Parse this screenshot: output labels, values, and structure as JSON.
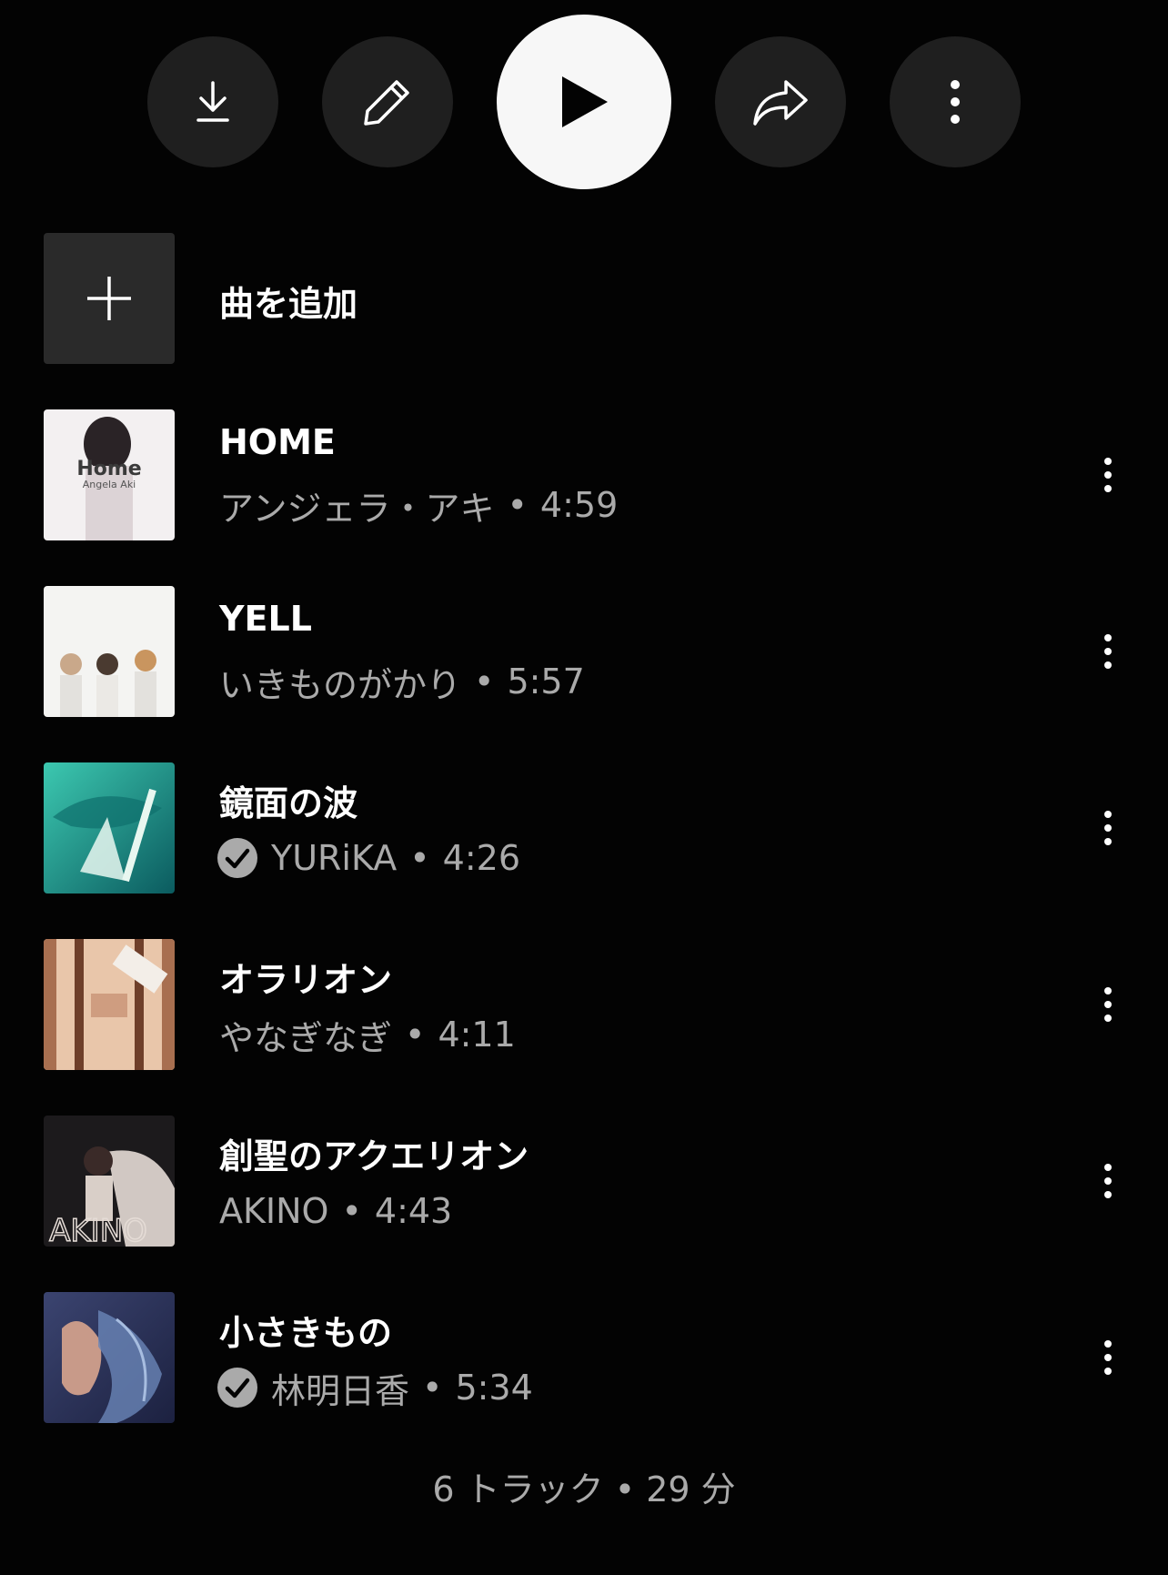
{
  "actions": {
    "download": "download-icon",
    "edit": "pencil-icon",
    "play": "play-icon",
    "share": "share-icon",
    "more": "more-vertical-icon"
  },
  "add_song_label": "曲を追加",
  "separator": "•",
  "tracks": [
    {
      "title": "HOME",
      "artist": "アンジェラ・アキ",
      "duration": "4:59",
      "verified": false,
      "art_colors": [
        "#f2eeee",
        "#d9cfd3",
        "#2a2326"
      ]
    },
    {
      "title": "YELL",
      "artist": "いきものがかり",
      "duration": "5:57",
      "verified": false,
      "art_colors": [
        "#f4f4f2",
        "#e8e6e2",
        "#c9a88a"
      ]
    },
    {
      "title": "鏡面の波",
      "artist": "YURiKA",
      "duration": "4:26",
      "verified": true,
      "art_colors": [
        "#27b3a3",
        "#0e6f6c",
        "#e8f7f0"
      ]
    },
    {
      "title": "オラリオン",
      "artist": "やなぎなぎ",
      "duration": "4:11",
      "verified": false,
      "art_colors": [
        "#e7c3a6",
        "#b07e5c",
        "#6f3f2a"
      ]
    },
    {
      "title": "創聖のアクエリオン",
      "artist": "AKINO",
      "duration": "4:43",
      "verified": false,
      "art_colors": [
        "#1c1a1c",
        "#e5dcd6",
        "#6e2f2a"
      ]
    },
    {
      "title": "小さきもの",
      "artist": "林明日香",
      "duration": "5:34",
      "verified": true,
      "art_colors": [
        "#2c3358",
        "#c89a89",
        "#6a86b8"
      ]
    }
  ],
  "footer": "6 トラック • 29 分"
}
